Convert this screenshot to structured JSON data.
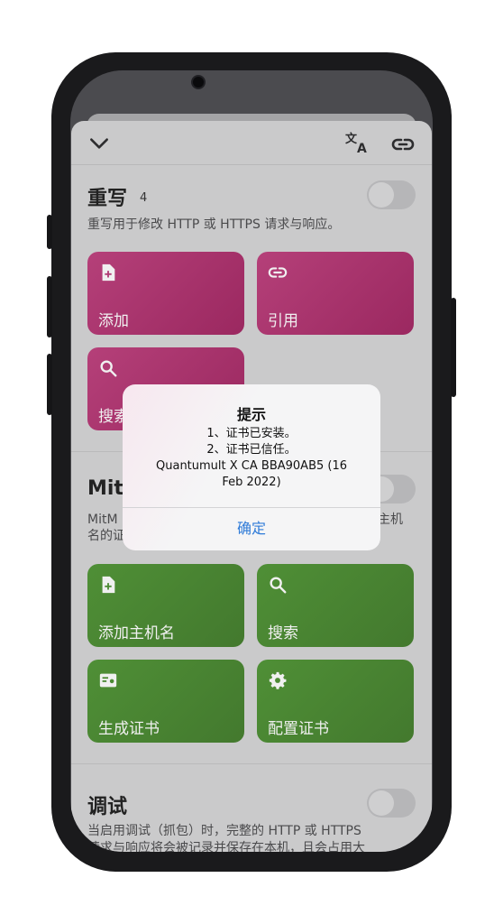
{
  "header": {
    "icons": [
      "chevron-down-icon",
      "translate-icon",
      "link-icon"
    ]
  },
  "rewrite": {
    "title": "重写",
    "count": "4",
    "desc": "重写用于修改 HTTP 或 HTTPS 请求与响应。",
    "enabled": false,
    "buttons": [
      {
        "label": "添加",
        "icon": "file-plus-icon"
      },
      {
        "label": "引用",
        "icon": "link-icon"
      },
      {
        "label": "搜索",
        "icon": "search-icon"
      }
    ]
  },
  "mitm": {
    "title": "Mit",
    "desc_line1": "MitM",
    "desc_line1_tail": "主机",
    "desc_line2": "名的证",
    "enabled": false,
    "buttons": [
      {
        "label": "添加主机名",
        "icon": "file-plus-icon"
      },
      {
        "label": "搜索",
        "icon": "search-icon"
      },
      {
        "label": "生成证书",
        "icon": "certificate-icon"
      },
      {
        "label": "配置证书",
        "icon": "gear-icon"
      }
    ]
  },
  "debug": {
    "title": "调试",
    "desc_line1": "当启用调试（抓包）时，完整的 HTTP 或 HTTPS",
    "desc_line2": "请求与响应将会被记录并保存在本机，且会占用大",
    "enabled": false
  },
  "alert": {
    "title": "提示",
    "line1": "1、证书已安装。",
    "line2": "2、证书已信任。",
    "line3": "Quantumult X CA BBA90AB5 (16",
    "line4": "Feb 2022)",
    "confirm": "确定"
  },
  "colors": {
    "rewrite_card": "#b54079",
    "mitm_card": "#4f8f36",
    "alert_button": "#2f7bd8"
  }
}
